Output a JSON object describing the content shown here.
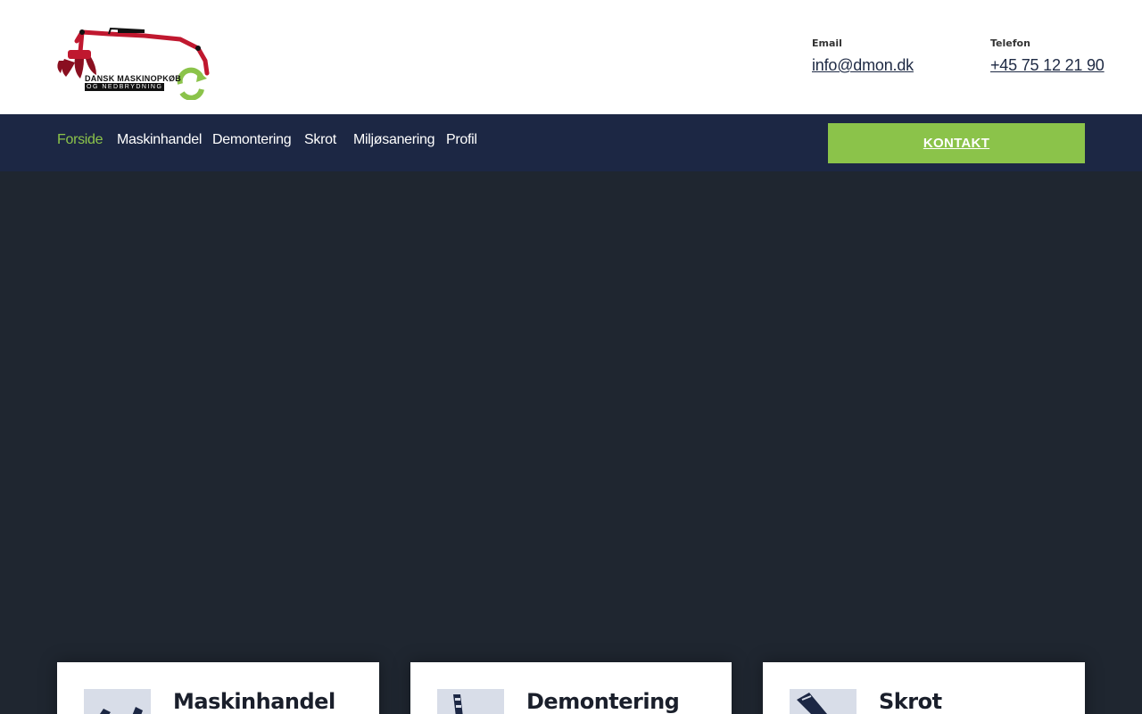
{
  "header": {
    "logo": {
      "line1": "DANSK MASKINOPKØB",
      "line2": "OG NEDBRYDNING"
    },
    "email": {
      "label": "Email",
      "value": "info@dmon.dk"
    },
    "phone": {
      "label": "Telefon",
      "value": "+45 75 12 21 90"
    }
  },
  "nav": {
    "items": [
      {
        "label": "Forside",
        "active": true
      },
      {
        "label": "Maskinhandel",
        "active": false
      },
      {
        "label": "Demontering",
        "active": false
      },
      {
        "label": "Skrot",
        "active": false
      },
      {
        "label": "Miljøsanering",
        "active": false
      },
      {
        "label": "Profil",
        "active": false
      }
    ],
    "cta_label": "KONTAKT"
  },
  "cards": [
    {
      "title": "Maskinhandel",
      "icon": "excavator-arm-icon"
    },
    {
      "title": "Demontering",
      "icon": "demolition-tool-icon"
    },
    {
      "title": "Skrot",
      "icon": "scrap-container-icon"
    }
  ],
  "colors": {
    "accent_green": "#8bc34a",
    "nav_bg": "#1c2744",
    "hero_bg": "#1f2630",
    "logo_red": "#c0182f"
  }
}
